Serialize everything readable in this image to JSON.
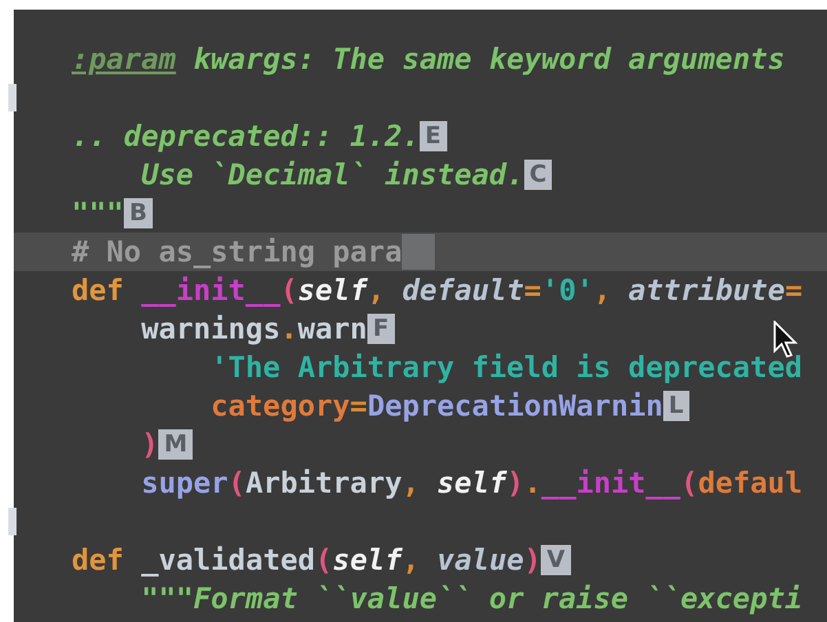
{
  "editor": {
    "lines": [
      {
        "current": false,
        "changed": false,
        "tokens": [
          {
            "kind": "directive",
            "text": ":param"
          },
          {
            "kind": "doc",
            "text": " kwargs: The same keyword arguments"
          }
        ]
      },
      {
        "current": false,
        "changed": true
      },
      {
        "current": false,
        "changed": false,
        "tokens": [
          {
            "kind": "doc",
            "text": ".. deprecated:: 1.2."
          },
          {
            "kind": "hint",
            "text": "E"
          }
        ]
      },
      {
        "current": false,
        "changed": false,
        "tokens": [
          {
            "kind": "indent"
          },
          {
            "kind": "doc",
            "text": "Use `Decimal` instead."
          },
          {
            "kind": "hint",
            "text": "C"
          }
        ]
      },
      {
        "current": false,
        "changed": false,
        "tokens": [
          {
            "kind": "doc",
            "text": "\"\"\""
          },
          {
            "kind": "hint",
            "text": "B"
          }
        ]
      },
      {
        "current": true,
        "changed": false,
        "tokens": [
          {
            "kind": "comment",
            "text": "# No as_string para"
          },
          {
            "kind": "block"
          }
        ]
      },
      {
        "current": false,
        "changed": false,
        "tokens": [
          {
            "kind": "keyword",
            "text": "def "
          },
          {
            "kind": "magic",
            "text": "__init__"
          },
          {
            "kind": "paren",
            "text": "("
          },
          {
            "kind": "self",
            "text": "self"
          },
          {
            "kind": "punct",
            "text": ","
          },
          {
            "kind": "param",
            "text": " default"
          },
          {
            "kind": "punct",
            "text": "="
          },
          {
            "kind": "string",
            "text": "'0'"
          },
          {
            "kind": "punct",
            "text": ","
          },
          {
            "kind": "param",
            "text": " attribute"
          },
          {
            "kind": "punct",
            "text": "="
          }
        ]
      },
      {
        "current": false,
        "changed": false,
        "tokens": [
          {
            "kind": "indent"
          },
          {
            "kind": "plain",
            "text": "warnings"
          },
          {
            "kind": "punct",
            "text": "."
          },
          {
            "kind": "plain",
            "text": "warn"
          },
          {
            "kind": "hint",
            "text": "F"
          }
        ]
      },
      {
        "current": false,
        "changed": false,
        "tokens": [
          {
            "kind": "indent"
          },
          {
            "kind": "indent"
          },
          {
            "kind": "string",
            "text": "'The Arbitrary field is deprecated"
          }
        ]
      },
      {
        "current": false,
        "changed": false,
        "tokens": [
          {
            "kind": "indent"
          },
          {
            "kind": "indent"
          },
          {
            "kind": "kwarg",
            "text": "category"
          },
          {
            "kind": "punct",
            "text": "="
          },
          {
            "kind": "builtin",
            "text": "DeprecationWarnin"
          },
          {
            "kind": "hint",
            "text": "L"
          }
        ]
      },
      {
        "current": false,
        "changed": false,
        "tokens": [
          {
            "kind": "indent"
          },
          {
            "kind": "paren",
            "text": ")"
          },
          {
            "kind": "hint",
            "text": "M"
          }
        ]
      },
      {
        "current": false,
        "changed": false,
        "tokens": [
          {
            "kind": "indent"
          },
          {
            "kind": "builtin",
            "text": "super"
          },
          {
            "kind": "paren",
            "text": "("
          },
          {
            "kind": "plain",
            "text": "Arbitrary"
          },
          {
            "kind": "punct",
            "text": ","
          },
          {
            "kind": "self",
            "text": " self"
          },
          {
            "kind": "paren",
            "text": ")"
          },
          {
            "kind": "punct",
            "text": "."
          },
          {
            "kind": "magic",
            "text": "__init__"
          },
          {
            "kind": "paren",
            "text": "("
          },
          {
            "kind": "kwarg",
            "text": "defaul"
          }
        ]
      },
      {
        "current": false,
        "changed": true
      },
      {
        "current": false,
        "changed": false,
        "tokens": [
          {
            "kind": "keyword",
            "text": "def"
          },
          {
            "kind": "plain",
            "text": " _validated"
          },
          {
            "kind": "paren",
            "text": "("
          },
          {
            "kind": "self",
            "text": "self"
          },
          {
            "kind": "punct",
            "text": ","
          },
          {
            "kind": "param",
            "text": " value"
          },
          {
            "kind": "paren",
            "text": ")"
          },
          {
            "kind": "hint",
            "text": "V"
          }
        ]
      },
      {
        "current": false,
        "changed": false,
        "tokens": [
          {
            "kind": "indent"
          },
          {
            "kind": "doc",
            "text": "\"\"\"Format ``value`` or raise ``excepti"
          }
        ]
      }
    ]
  }
}
